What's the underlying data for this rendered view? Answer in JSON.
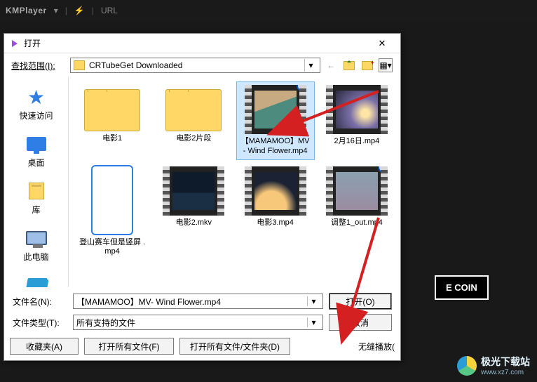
{
  "app": {
    "name": "KMPlayer",
    "extra": "URL"
  },
  "bg": {
    "ecoin": "E COIN"
  },
  "dialog": {
    "title": "打开",
    "lookin_label": "查找范围(I):",
    "lookin_value": "CRTubeGet Downloaded",
    "places": {
      "quick": "快速访问",
      "desktop": "桌面",
      "libraries": "库",
      "thispc": "此电脑",
      "network": "网络"
    },
    "items": [
      {
        "name": "电影1",
        "kind": "folder"
      },
      {
        "name": "电影2片段",
        "kind": "folder"
      },
      {
        "name": "【MAMAMOO】MV- Wind Flower.mp4",
        "kind": "video",
        "thumb": "tmv",
        "selected": true,
        "badge": "1"
      },
      {
        "name": "2月16日.mp4",
        "kind": "video",
        "thumb": "tstar"
      },
      {
        "name": "登山赛车但是竖屏 .mp4",
        "kind": "phone"
      },
      {
        "name": "电影2.mkv",
        "kind": "video",
        "thumb": "tship"
      },
      {
        "name": "电影3.mp4",
        "kind": "video",
        "thumb": "tplanet"
      },
      {
        "name": "调整1_out.mp4",
        "kind": "video",
        "thumb": "tcrowd",
        "badge": "2"
      }
    ],
    "filename_label": "文件名(N):",
    "filename_value": "【MAMAMOO】MV- Wind Flower.mp4",
    "filetype_label": "文件类型(T):",
    "filetype_value": "所有支持的文件",
    "open_btn": "打开(O)",
    "cancel_btn": "取消",
    "fav_btn": "收藏夹(A)",
    "openall_btn": "打开所有文件(F)",
    "openallfold_btn": "打开所有文件/文件夹(D)",
    "seamless": "无缝播放("
  },
  "logo": {
    "text": "极光下载站",
    "url": "www.xz7.com"
  }
}
